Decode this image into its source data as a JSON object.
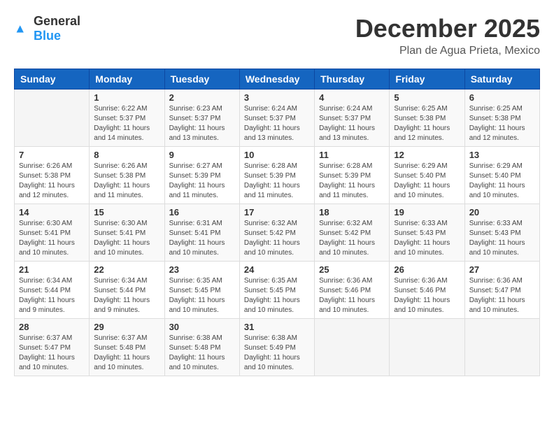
{
  "logo": {
    "text_general": "General",
    "text_blue": "Blue"
  },
  "header": {
    "month": "December 2025",
    "location": "Plan de Agua Prieta, Mexico"
  },
  "weekdays": [
    "Sunday",
    "Monday",
    "Tuesday",
    "Wednesday",
    "Thursday",
    "Friday",
    "Saturday"
  ],
  "weeks": [
    [
      {
        "day": "",
        "info": ""
      },
      {
        "day": "1",
        "info": "Sunrise: 6:22 AM\nSunset: 5:37 PM\nDaylight: 11 hours\nand 14 minutes."
      },
      {
        "day": "2",
        "info": "Sunrise: 6:23 AM\nSunset: 5:37 PM\nDaylight: 11 hours\nand 13 minutes."
      },
      {
        "day": "3",
        "info": "Sunrise: 6:24 AM\nSunset: 5:37 PM\nDaylight: 11 hours\nand 13 minutes."
      },
      {
        "day": "4",
        "info": "Sunrise: 6:24 AM\nSunset: 5:37 PM\nDaylight: 11 hours\nand 13 minutes."
      },
      {
        "day": "5",
        "info": "Sunrise: 6:25 AM\nSunset: 5:38 PM\nDaylight: 11 hours\nand 12 minutes."
      },
      {
        "day": "6",
        "info": "Sunrise: 6:25 AM\nSunset: 5:38 PM\nDaylight: 11 hours\nand 12 minutes."
      }
    ],
    [
      {
        "day": "7",
        "info": "Sunrise: 6:26 AM\nSunset: 5:38 PM\nDaylight: 11 hours\nand 12 minutes."
      },
      {
        "day": "8",
        "info": "Sunrise: 6:26 AM\nSunset: 5:38 PM\nDaylight: 11 hours\nand 11 minutes."
      },
      {
        "day": "9",
        "info": "Sunrise: 6:27 AM\nSunset: 5:39 PM\nDaylight: 11 hours\nand 11 minutes."
      },
      {
        "day": "10",
        "info": "Sunrise: 6:28 AM\nSunset: 5:39 PM\nDaylight: 11 hours\nand 11 minutes."
      },
      {
        "day": "11",
        "info": "Sunrise: 6:28 AM\nSunset: 5:39 PM\nDaylight: 11 hours\nand 11 minutes."
      },
      {
        "day": "12",
        "info": "Sunrise: 6:29 AM\nSunset: 5:40 PM\nDaylight: 11 hours\nand 10 minutes."
      },
      {
        "day": "13",
        "info": "Sunrise: 6:29 AM\nSunset: 5:40 PM\nDaylight: 11 hours\nand 10 minutes."
      }
    ],
    [
      {
        "day": "14",
        "info": "Sunrise: 6:30 AM\nSunset: 5:41 PM\nDaylight: 11 hours\nand 10 minutes."
      },
      {
        "day": "15",
        "info": "Sunrise: 6:30 AM\nSunset: 5:41 PM\nDaylight: 11 hours\nand 10 minutes."
      },
      {
        "day": "16",
        "info": "Sunrise: 6:31 AM\nSunset: 5:41 PM\nDaylight: 11 hours\nand 10 minutes."
      },
      {
        "day": "17",
        "info": "Sunrise: 6:32 AM\nSunset: 5:42 PM\nDaylight: 11 hours\nand 10 minutes."
      },
      {
        "day": "18",
        "info": "Sunrise: 6:32 AM\nSunset: 5:42 PM\nDaylight: 11 hours\nand 10 minutes."
      },
      {
        "day": "19",
        "info": "Sunrise: 6:33 AM\nSunset: 5:43 PM\nDaylight: 11 hours\nand 10 minutes."
      },
      {
        "day": "20",
        "info": "Sunrise: 6:33 AM\nSunset: 5:43 PM\nDaylight: 11 hours\nand 10 minutes."
      }
    ],
    [
      {
        "day": "21",
        "info": "Sunrise: 6:34 AM\nSunset: 5:44 PM\nDaylight: 11 hours\nand 9 minutes."
      },
      {
        "day": "22",
        "info": "Sunrise: 6:34 AM\nSunset: 5:44 PM\nDaylight: 11 hours\nand 9 minutes."
      },
      {
        "day": "23",
        "info": "Sunrise: 6:35 AM\nSunset: 5:45 PM\nDaylight: 11 hours\nand 10 minutes."
      },
      {
        "day": "24",
        "info": "Sunrise: 6:35 AM\nSunset: 5:45 PM\nDaylight: 11 hours\nand 10 minutes."
      },
      {
        "day": "25",
        "info": "Sunrise: 6:36 AM\nSunset: 5:46 PM\nDaylight: 11 hours\nand 10 minutes."
      },
      {
        "day": "26",
        "info": "Sunrise: 6:36 AM\nSunset: 5:46 PM\nDaylight: 11 hours\nand 10 minutes."
      },
      {
        "day": "27",
        "info": "Sunrise: 6:36 AM\nSunset: 5:47 PM\nDaylight: 11 hours\nand 10 minutes."
      }
    ],
    [
      {
        "day": "28",
        "info": "Sunrise: 6:37 AM\nSunset: 5:47 PM\nDaylight: 11 hours\nand 10 minutes."
      },
      {
        "day": "29",
        "info": "Sunrise: 6:37 AM\nSunset: 5:48 PM\nDaylight: 11 hours\nand 10 minutes."
      },
      {
        "day": "30",
        "info": "Sunrise: 6:38 AM\nSunset: 5:48 PM\nDaylight: 11 hours\nand 10 minutes."
      },
      {
        "day": "31",
        "info": "Sunrise: 6:38 AM\nSunset: 5:49 PM\nDaylight: 11 hours\nand 10 minutes."
      },
      {
        "day": "",
        "info": ""
      },
      {
        "day": "",
        "info": ""
      },
      {
        "day": "",
        "info": ""
      }
    ]
  ]
}
